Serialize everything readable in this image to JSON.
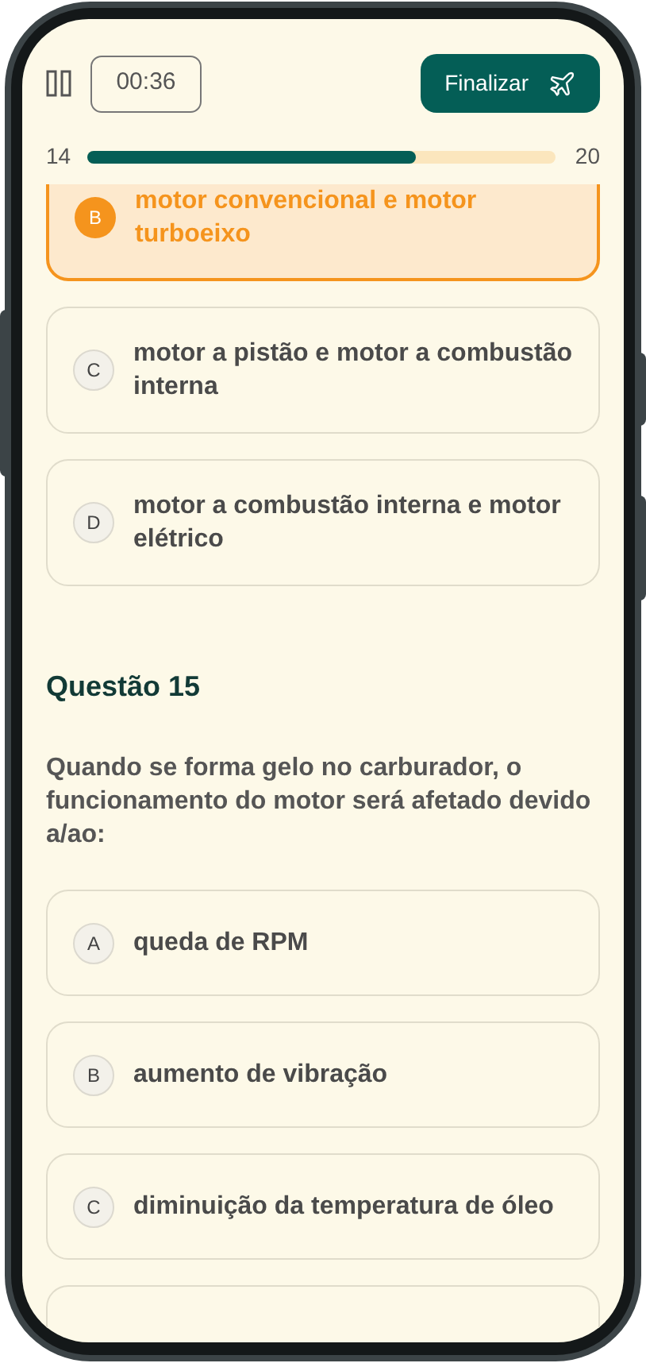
{
  "header": {
    "timer": "00:36",
    "finish_button": "Finalizar"
  },
  "progress": {
    "current": "14",
    "total": "20",
    "level": 0.7
  },
  "previous_options": [
    {
      "letter": "B",
      "text": "motor convencional e motor turboeixo",
      "selected": true
    },
    {
      "letter": "C",
      "text": "motor a pistão e motor a combustão interna",
      "selected": false
    },
    {
      "letter": "D",
      "text": "motor a combustão interna e motor elétrico",
      "selected": false
    }
  ],
  "question": {
    "title": "Questão 15",
    "text": "Quando se forma gelo no carburador, o funcionamento do motor será afetado devido a/ao:",
    "options": [
      {
        "letter": "A",
        "text": "queda de RPM",
        "selected": false
      },
      {
        "letter": "B",
        "text": "aumento de vibração",
        "selected": false
      },
      {
        "letter": "C",
        "text": "diminuição da temperatura de óleo",
        "selected": false
      }
    ]
  }
}
